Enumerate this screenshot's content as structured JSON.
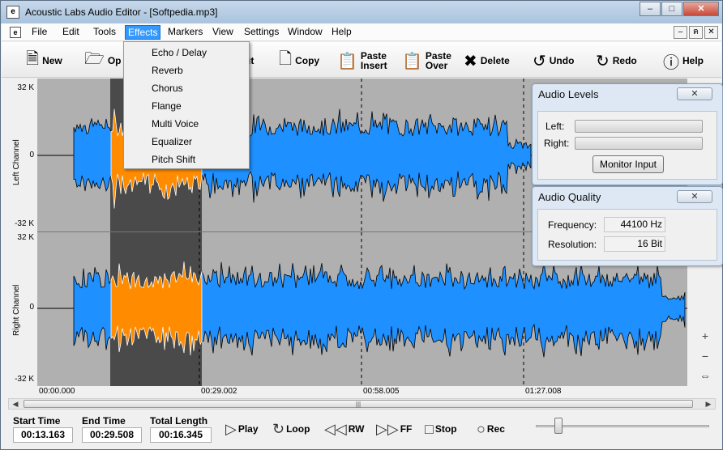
{
  "window": {
    "title": "Acoustic Labs Audio Editor - [Softpedia.mp3]",
    "app_icon": "e",
    "minimize": "–",
    "maximize": "□",
    "close": "✕"
  },
  "menu": {
    "items": [
      "File",
      "Edit",
      "Tools",
      "Effects",
      "Markers",
      "View",
      "Settings",
      "Window",
      "Help"
    ],
    "active": "Effects"
  },
  "mdi_buttons": [
    "–",
    "ฅ",
    "✕"
  ],
  "effects_menu": [
    "Echo / Delay",
    "Reverb",
    "Chorus",
    "Flange",
    "Multi Voice",
    "Equalizer",
    "Pitch Shift"
  ],
  "toolbar": {
    "new": "New",
    "open": "Op",
    "cut": "ut",
    "copy": "Copy",
    "paste_insert_1": "Paste",
    "paste_insert_2": "Insert",
    "paste_over_1": "Paste",
    "paste_over_2": "Over",
    "delete": "Delete",
    "undo": "Undo",
    "redo": "Redo",
    "help": "Help"
  },
  "channels": {
    "left_label": "Left Channel",
    "right_label": "Right Channel",
    "top_max": "32 K",
    "top_zero": "0",
    "top_min": "-32 K",
    "bottom_max": "32 K",
    "bottom_zero": "0",
    "bottom_min": "-32 K"
  },
  "timeline": [
    "00:00.000",
    "00:29.002",
    "00:58.005",
    "01:27.008"
  ],
  "waveform_colors": {
    "wave": "#1e90ff",
    "selected": "#ff8c00",
    "selection_bg": "#4a4a4a",
    "background": "#b0b0b0"
  },
  "audio_levels": {
    "title": "Audio Levels",
    "left_label": "Left:",
    "right_label": "Right:",
    "left_level": 0,
    "right_level": 0,
    "button": "Monitor Input"
  },
  "audio_quality": {
    "title": "Audio Quality",
    "frequency_label": "Frequency:",
    "frequency_value": "44100 Hz",
    "resolution_label": "Resolution:",
    "resolution_value": "16 Bit"
  },
  "transport": {
    "start_label": "Start Time",
    "start_value": "00:13.163",
    "end_label": "End Time",
    "end_value": "00:29.508",
    "total_label": "Total Length",
    "total_value": "00:16.345",
    "play": "Play",
    "loop": "Loop",
    "rw": "RW",
    "ff": "FF",
    "stop": "Stop",
    "rec": "Rec",
    "volume_level": 0.13
  },
  "scrollbar_grip": "|||",
  "zoom_icons": [
    "+",
    "−",
    "⇔"
  ]
}
